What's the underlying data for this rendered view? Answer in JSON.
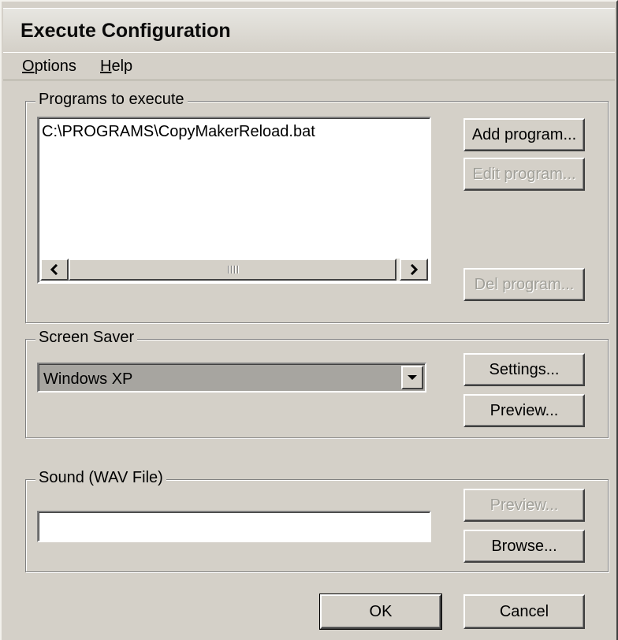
{
  "window": {
    "title": "Execute Configuration"
  },
  "menu": {
    "options": "Options",
    "help": "Help"
  },
  "programs": {
    "group_label": "Programs to execute",
    "items": [
      "C:\\PROGRAMS\\CopyMakerReload.bat"
    ],
    "add_button": "Add program...",
    "edit_button": "Edit program...",
    "del_button": "Del program..."
  },
  "screensaver": {
    "group_label": "Screen Saver",
    "selected": "Windows XP",
    "settings_button": "Settings...",
    "preview_button": "Preview..."
  },
  "sound": {
    "group_label": "Sound (WAV File)",
    "value": "",
    "preview_button": "Preview...",
    "browse_button": "Browse..."
  },
  "footer": {
    "ok_button": "OK",
    "cancel_button": "Cancel"
  },
  "icons": {
    "scroll_left": "arrow-left-icon",
    "scroll_right": "arrow-right-icon",
    "dropdown": "chevron-down-icon"
  }
}
